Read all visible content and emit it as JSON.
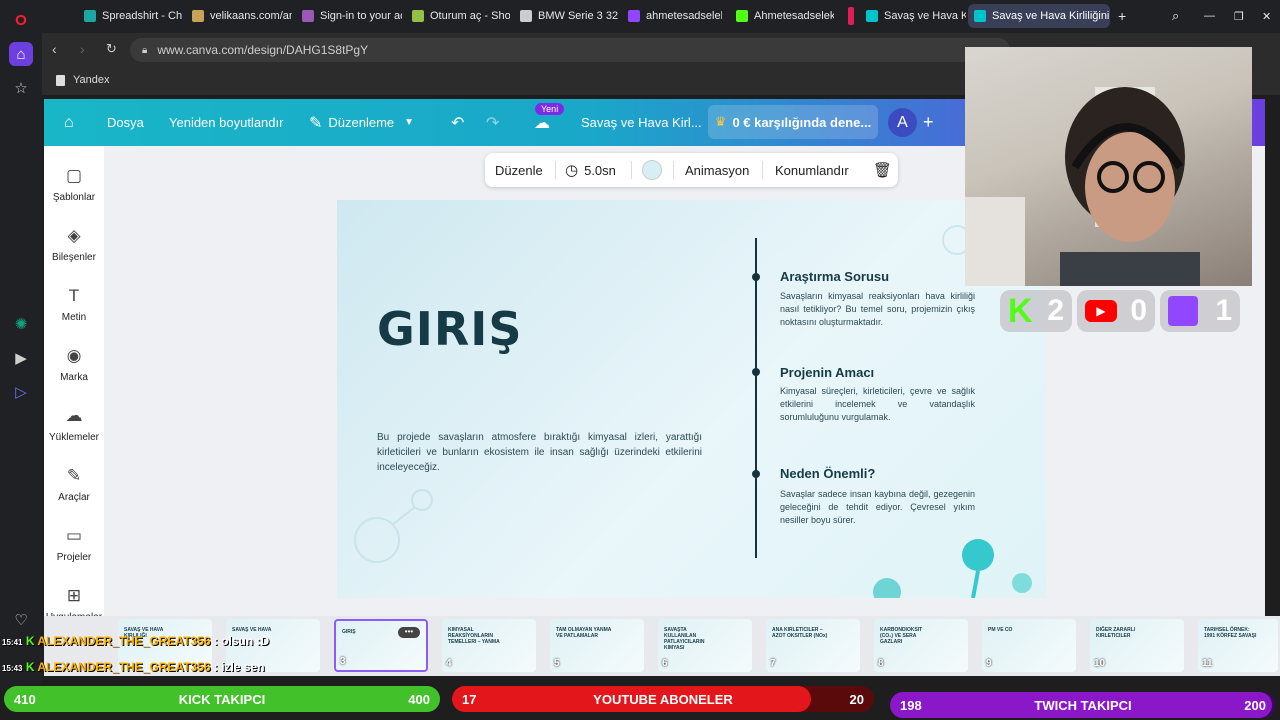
{
  "browser": {
    "tabs": [
      {
        "label": "Spreadshirt - Check",
        "color": "#1fa6a0"
      },
      {
        "label": "velikaans.com/antr",
        "color": "#c8a25b"
      },
      {
        "label": "Sign-in to your acc",
        "color": "#9b59b6"
      },
      {
        "label": "Oturum aç - Shopi",
        "color": "#96bf48"
      },
      {
        "label": "BMW Serie 3 320d",
        "color": "#cccccc"
      },
      {
        "label": "ahmetesadselek",
        "color": "#9146ff"
      },
      {
        "label": "Ahmetesadselek St",
        "color": "#53fc18"
      },
      {
        "label": "",
        "color": "#e01e5a"
      },
      {
        "label": "Savaş ve Hava Kirli",
        "color": "#00c4cc"
      },
      {
        "label": "Savaş ve Hava Kirliliğinin",
        "color": "#00c4cc"
      }
    ],
    "url": "www.canva.com/design/DAHG1S8tPgY",
    "bookmark": "Yandex",
    "new_tab": "+"
  },
  "canva": {
    "header": {
      "file": "Dosya",
      "resize": "Yeniden boyutlandır",
      "edit": "Düzenleme",
      "new_badge": "Yeni",
      "doc_title": "Savaş ve Hava Kirl...",
      "trial": "0 € karşılığında dene...",
      "avatar": "A",
      "add": "+"
    },
    "nav": [
      {
        "label": "Şablonlar",
        "icon": "▢"
      },
      {
        "label": "Bileşenler",
        "icon": "◈"
      },
      {
        "label": "Metin",
        "icon": "T"
      },
      {
        "label": "Marka",
        "icon": "◉"
      },
      {
        "label": "Yüklemeler",
        "icon": "☁"
      },
      {
        "label": "Araçlar",
        "icon": "✎"
      },
      {
        "label": "Projeler",
        "icon": "▭"
      },
      {
        "label": "Uygulamalar",
        "icon": "⊞"
      }
    ],
    "context_bar": {
      "edit": "Düzenle",
      "duration": "5.0sn",
      "animation": "Animasyon",
      "position": "Konumlandır"
    },
    "slide": {
      "title": "GIRIŞ",
      "description": "Bu projede savaşların atmosfere bıraktığı kimyasal izleri, yarattığı kirleticileri ve bunların ekosistem ile insan sağlığı üzerindeki etkilerini inceleyeceğiz.",
      "items": [
        {
          "heading": "Araştırma Sorusu",
          "text": "Savaşların kimyasal reaksiyonları hava kirliliği nasıl tetikliyor? Bu temel soru, projemizin çıkış noktasını oluşturmaktadır."
        },
        {
          "heading": "Projenin Amacı",
          "text": "Kimyasal süreçleri, kirleticileri, çevre ve sağlık etkilerini incelemek ve vatandaşlık sorumluluğunu vurgulamak."
        },
        {
          "heading": "Neden Önemli?",
          "text": "Savaşlar sadece insan kaybına değil, gezegenin geleceğini de tehdit ediyor. Çevresel yıkım nesiller boyu sürer."
        }
      ]
    },
    "thumbnails": [
      {
        "num": "",
        "title": "SAVAŞ VE HAVA KIRLILIĞI"
      },
      {
        "num": "",
        "title": "SAVAŞ VE HAVA"
      },
      {
        "num": "3",
        "title": "GIRIŞ"
      },
      {
        "num": "4",
        "title": "KIMYASAL REAKSİYONLARIN TEMELLERI – YANMA"
      },
      {
        "num": "5",
        "title": "TAM OLMAYAN YANMA VE PATLAMALAR"
      },
      {
        "num": "6",
        "title": "SAVAŞTA KULLANILAN PATLAYICILARIN KIMYASI"
      },
      {
        "num": "7",
        "title": "ANA KIRLETICILER – AZOT OKSITLER (NOx)"
      },
      {
        "num": "8",
        "title": "KARBONDIOKSIT (CO₂) VE SERA GAZLARI"
      },
      {
        "num": "9",
        "title": "PM VE CO"
      },
      {
        "num": "10",
        "title": "DIĞER ZARARLI KIRLETICILER"
      },
      {
        "num": "11",
        "title": "TARIHSEL ÖRNEK: 1991 KÖRFEZ SAVAŞI"
      }
    ]
  },
  "stream": {
    "counters": {
      "kick": "2",
      "youtube": "0",
      "twitch": "1"
    },
    "chat": [
      {
        "time": "15:41",
        "user": "ALEXANDER_THE_GREAT356",
        "msg": ": olsun :D"
      },
      {
        "time": "15:43",
        "user": "ALEXANDER_THE_GREAT356",
        "msg": ": izle sen"
      }
    ],
    "bars": {
      "kick": {
        "label": "KICK TAKIPCI",
        "current": "410",
        "goal": "400",
        "progress": 1.0
      },
      "youtube": {
        "label": "YOUTUBE ABONELER",
        "current": "17",
        "goal": "20",
        "progress": 0.85
      },
      "twitch": {
        "label": "TWICH TAKIPCI",
        "current": "198",
        "goal": "200",
        "progress": 0.99
      }
    }
  }
}
